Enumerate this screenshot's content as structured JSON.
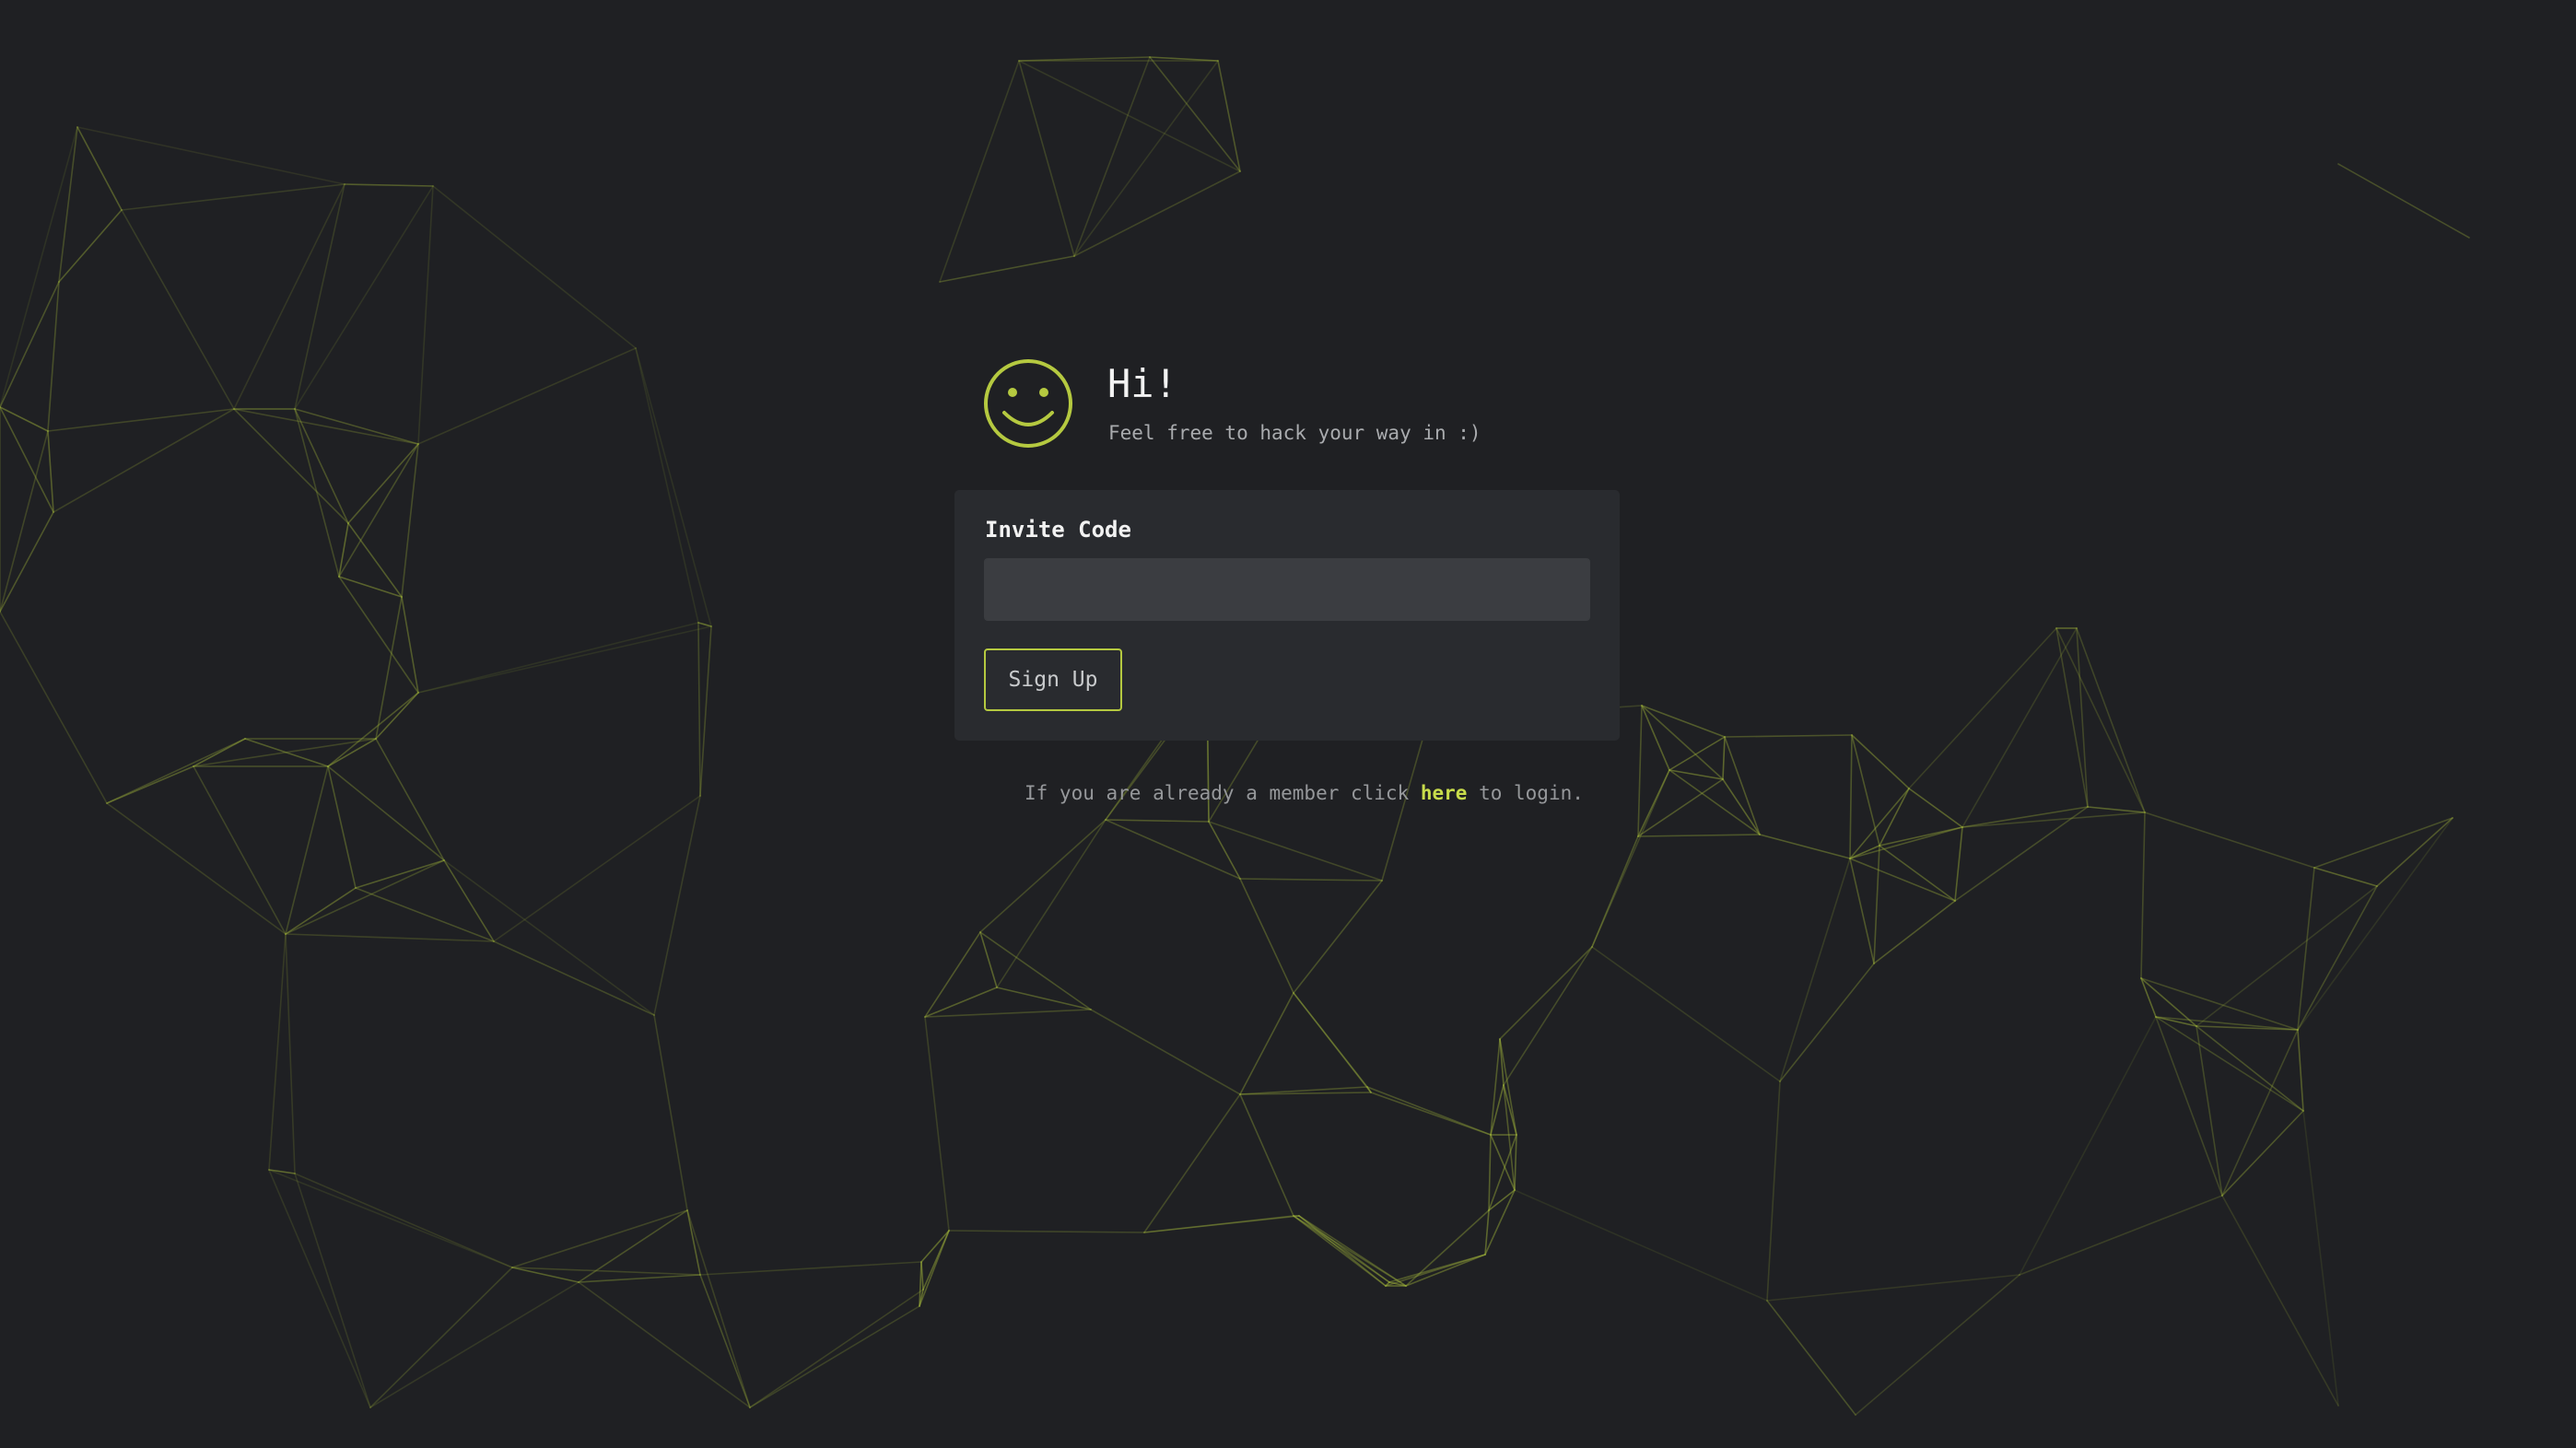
{
  "colors": {
    "background": "#1f2023",
    "card": "#292b2f",
    "input": "#3b3d41",
    "accent": "#b5c940",
    "link": "#c8dc4b",
    "network_lines": "#9fb33a"
  },
  "header": {
    "icon": "smiley-icon",
    "title": "Hi!",
    "subtitle": "Feel free to hack your way in :)"
  },
  "form": {
    "invite_label": "Invite Code",
    "invite_value": "",
    "invite_placeholder": "",
    "submit_label": "Sign Up"
  },
  "footer": {
    "prefix": "If you are already a member click ",
    "link_label": "here",
    "suffix": " to login."
  }
}
